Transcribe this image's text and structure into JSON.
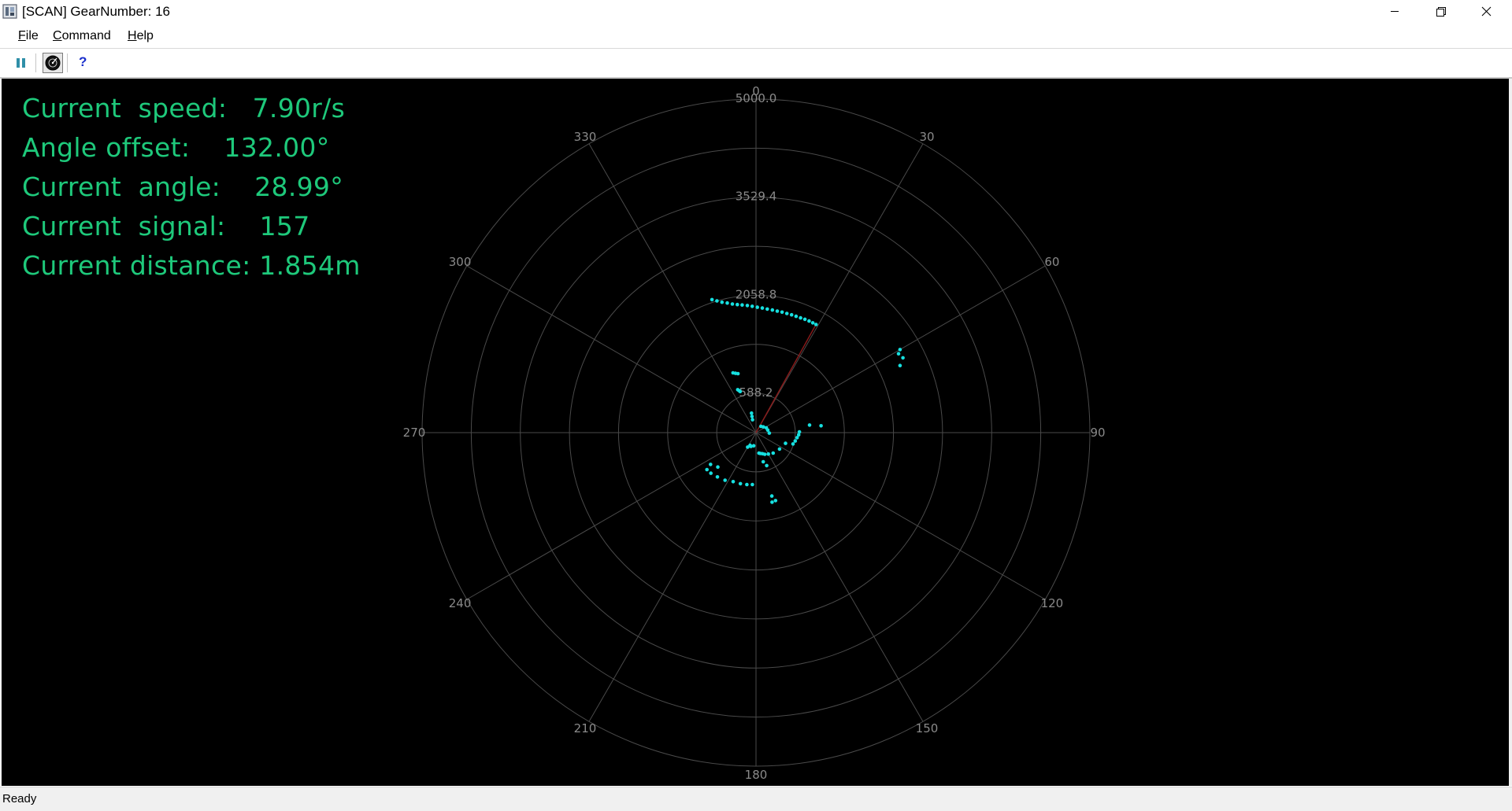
{
  "window": {
    "title": "[SCAN] GearNumber: 16"
  },
  "menu": {
    "items": [
      {
        "label": "File",
        "accel": "F"
      },
      {
        "label": "Command",
        "accel": "C"
      },
      {
        "label": "Help",
        "accel": "H"
      }
    ]
  },
  "toolbar": {
    "buttons": [
      "pause-icon",
      "radar-icon",
      "help-icon"
    ],
    "help_glyph": "?"
  },
  "readout": {
    "speed": "Current  speed:   7.90r/s",
    "angle_offset": "Angle offset:    132.00°",
    "angle": "Current  angle:    28.99°",
    "signal": "Current  signal:    157",
    "distance": "Current distance: 1.854m"
  },
  "status": {
    "text": "Ready"
  },
  "chart_data": {
    "type": "scatter",
    "coordinate_system": "polar",
    "angle_unit": "deg",
    "angle_zero": "top",
    "angle_direction": "clockwise",
    "radial_max": 5000,
    "ring_labels": [
      "5000.0",
      "3529.4",
      "2058.8",
      "588.2"
    ],
    "ring_values": [
      5000.0,
      3529.4,
      2058.8,
      588.2
    ],
    "angle_labels": [
      "0",
      "30",
      "60",
      "90",
      "120",
      "150",
      "180",
      "210",
      "240",
      "270",
      "300",
      "330"
    ],
    "current_beam": {
      "angle": 28.99,
      "distance": 1854
    },
    "colors": {
      "points": "#16e0e0",
      "beam": "#8b1a1a",
      "grid": "#4a4a4a",
      "labels": "#8a8a8a"
    },
    "series": [
      {
        "points": [
          [
            -18.3,
            2100
          ],
          [
            -16.5,
            2060
          ],
          [
            -14.6,
            2020
          ],
          [
            -12.5,
            1990
          ],
          [
            -10.4,
            1960
          ],
          [
            -8.3,
            1940
          ],
          [
            -6.2,
            1925
          ],
          [
            -3.9,
            1910
          ],
          [
            -1.7,
            1895
          ],
          [
            0.6,
            1880
          ],
          [
            2.9,
            1870
          ],
          [
            5.2,
            1860
          ],
          [
            7.6,
            1855
          ],
          [
            9.9,
            1850
          ],
          [
            12.2,
            1848
          ],
          [
            14.5,
            1845
          ],
          [
            16.8,
            1845
          ],
          [
            19.0,
            1845
          ],
          [
            21.2,
            1846
          ],
          [
            23.3,
            1850
          ],
          [
            25.4,
            1852
          ],
          [
            27.3,
            1853
          ],
          [
            28.99,
            1854
          ],
          [
            -21,
            960
          ],
          [
            -19,
            940
          ],
          [
            -17,
            925
          ],
          [
            -23,
            700
          ],
          [
            -22,
            680
          ],
          [
            -21,
            660
          ],
          [
            -14,
            250
          ],
          [
            -13,
            300
          ],
          [
            -15,
            200
          ],
          [
            -170,
            200
          ],
          [
            -160,
            220
          ],
          [
            -150,
            250
          ],
          [
            -155,
            210
          ],
          [
            38,
            120
          ],
          [
            52,
            140
          ],
          [
            65,
            170
          ],
          [
            78,
            180
          ],
          [
            92,
            200
          ],
          [
            107,
            580
          ],
          [
            102,
            600
          ],
          [
            97,
            620
          ],
          [
            93,
            640
          ],
          [
            89,
            650
          ],
          [
            110,
            470
          ],
          [
            125,
            430
          ],
          [
            140,
            400
          ],
          [
            150,
            370
          ],
          [
            158,
            350
          ],
          [
            163,
            330
          ],
          [
            168,
            320
          ],
          [
            172,
            310
          ],
          [
            166,
            450
          ],
          [
            162,
            520
          ],
          [
            184,
            780
          ],
          [
            190,
            790
          ],
          [
            197,
            800
          ],
          [
            205,
            810
          ],
          [
            213,
            850
          ],
          [
            221,
            880
          ],
          [
            228,
            910
          ],
          [
            233,
            920
          ],
          [
            166,
            980
          ],
          [
            167,
            1070
          ],
          [
            164,
            1060
          ],
          [
            82,
            810
          ],
          [
            84,
            980
          ],
          [
            65,
            2380
          ],
          [
            63,
            2470
          ],
          [
            61,
            2440
          ],
          [
            60,
            2490
          ],
          [
            228,
            770
          ],
          [
            235,
            830
          ]
        ]
      }
    ]
  }
}
